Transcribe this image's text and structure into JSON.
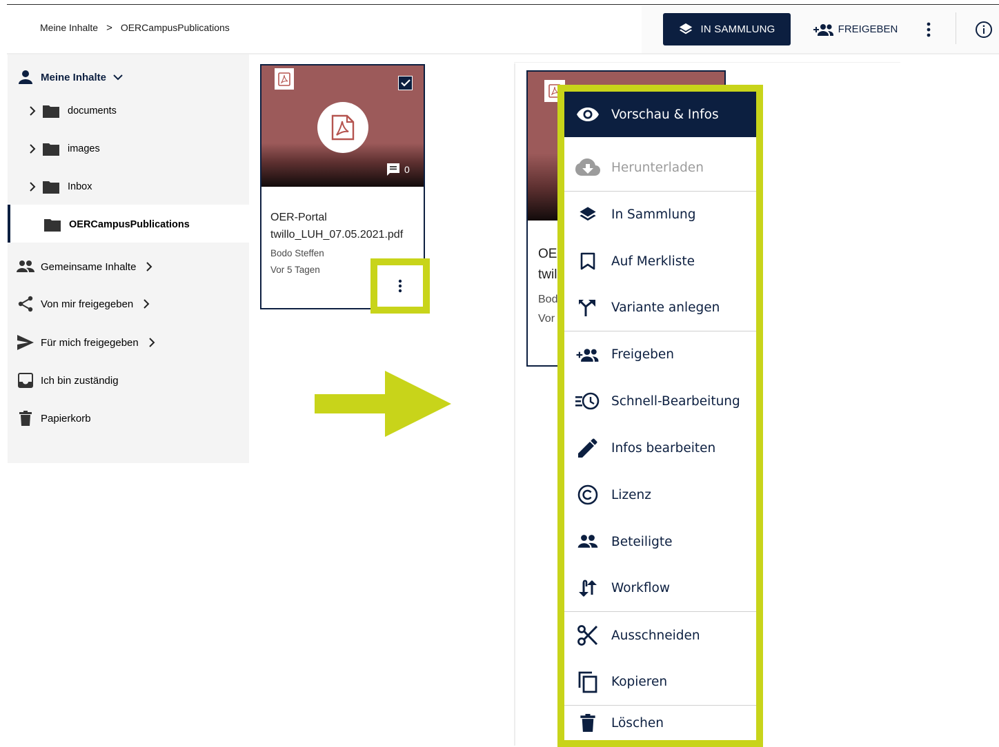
{
  "breadcrumb": {
    "root": "Meine Inhalte",
    "current": "OERCampusPublications"
  },
  "header": {
    "collection_button": "IN SAMMLUNG",
    "share_button": "FREIGEBEN"
  },
  "sidebar": {
    "my_content": "Meine Inhalte",
    "folders": [
      "documents",
      "images",
      "Inbox",
      "OERCampusPublications"
    ],
    "shared_content": "Gemeinsame Inhalte",
    "shared_by_me": "Von mir freigegeben",
    "shared_with_me": "Für mich freigegeben",
    "responsible": "Ich bin zuständig",
    "trash": "Papierkorb"
  },
  "card": {
    "comment_count": "0",
    "title_line1": "OER-Portal",
    "title_line2": "twillo_LUH_07.05.2021.pdf",
    "author": "Bodo Steffen",
    "date": "Vor 5 Tagen"
  },
  "card_partial": {
    "line1": "OE",
    "line2": "twil",
    "line3": "Bod",
    "line4": "Vor"
  },
  "menu": {
    "items": [
      {
        "label": "Vorschau & Infos",
        "icon": "eye-icon",
        "state": "active"
      },
      {
        "label": "Herunterladen",
        "icon": "cloud-download-icon",
        "state": "disabled"
      },
      {
        "label": "In Sammlung",
        "icon": "layers-icon",
        "state": "normal"
      },
      {
        "label": "Auf Merkliste",
        "icon": "bookmark-icon",
        "state": "normal"
      },
      {
        "label": "Variante anlegen",
        "icon": "fork-icon",
        "state": "normal"
      },
      {
        "label": "Freigeben",
        "icon": "group-add-icon",
        "state": "normal"
      },
      {
        "label": "Schnell-Bearbeitung",
        "icon": "quick-edit-icon",
        "state": "normal"
      },
      {
        "label": "Infos bearbeiten",
        "icon": "pencil-icon",
        "state": "normal"
      },
      {
        "label": "Lizenz",
        "icon": "copyright-icon",
        "state": "normal"
      },
      {
        "label": "Beteiligte",
        "icon": "people-icon",
        "state": "normal"
      },
      {
        "label": "Workflow",
        "icon": "swap-vert-icon",
        "state": "normal"
      },
      {
        "label": "Ausschneiden",
        "icon": "scissors-icon",
        "state": "normal"
      },
      {
        "label": "Kopieren",
        "icon": "copy-icon",
        "state": "normal"
      },
      {
        "label": "Löschen",
        "icon": "trash-icon",
        "state": "normal"
      }
    ]
  },
  "colors": {
    "primary": "#0c1f40",
    "highlight": "#c8d41a",
    "thumbnail": "#9c5a5a"
  }
}
